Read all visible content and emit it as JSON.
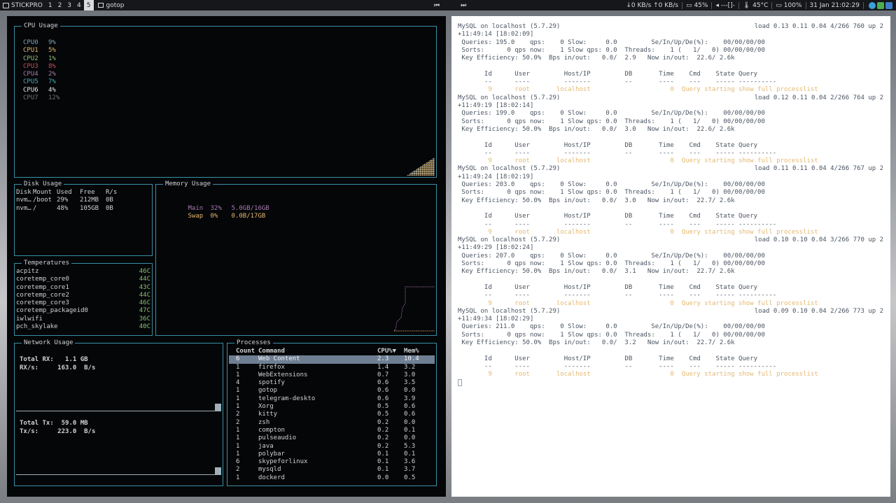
{
  "topbar": {
    "brand": "STICKPRO",
    "workspaces": [
      "1",
      "2",
      "3",
      "4",
      "5"
    ],
    "active_workspace": "5",
    "window_title": "gotop",
    "net": "↓0 KB/s ↑0 KB/s",
    "brightness": "45%",
    "volume": "---[]-",
    "temp": "45°C",
    "battery": "100%",
    "datetime": "31 Jan 21:02:29"
  },
  "gotop": {
    "cpu": {
      "title": "CPU Usage",
      "cores": [
        {
          "name": "CPU0",
          "value": "9%",
          "color": "#7aa2b8"
        },
        {
          "name": "CPU1",
          "value": "5%",
          "color": "#e5b870"
        },
        {
          "name": "CPU2",
          "value": "1%",
          "color": "#8dbf77"
        },
        {
          "name": "CPU3",
          "value": "8%",
          "color": "#c0505a"
        },
        {
          "name": "CPU4",
          "value": "2%",
          "color": "#a77bb1"
        },
        {
          "name": "CPU5",
          "value": "7%",
          "color": "#4fa9b8"
        },
        {
          "name": "CPU6",
          "value": "4%",
          "color": "#e8e8e8"
        },
        {
          "name": "CPU7",
          "value": "12%",
          "color": "#6f7378"
        }
      ]
    },
    "disk": {
      "title": "Disk Usage",
      "headers": [
        "Disk",
        "Mount",
        "Used",
        "Free",
        "R/s"
      ],
      "rows": [
        [
          "nvm…",
          "/boot",
          "29%",
          "212MB",
          "0B"
        ],
        [
          "nvm…",
          "/",
          "48%",
          "105GB",
          "0B"
        ]
      ]
    },
    "memory": {
      "title": "Memory Usage",
      "main": {
        "label": "Main",
        "pct": "32%",
        "value": "5.0GB/16GB"
      },
      "swap": {
        "label": "Swap",
        "pct": "0%",
        "value": "0.0B/17GB"
      }
    },
    "temps": {
      "title": "Temperatures",
      "rows": [
        [
          "acpitz",
          "46C"
        ],
        [
          "coretemp_core0",
          "44C"
        ],
        [
          "coretemp_core1",
          "43C"
        ],
        [
          "coretemp_core2",
          "44C"
        ],
        [
          "coretemp_core3",
          "46C"
        ],
        [
          "coretemp_packageid0",
          "47C"
        ],
        [
          "iwlwifi",
          "36C"
        ],
        [
          "pch_skylake",
          "40C"
        ]
      ]
    },
    "network": {
      "title": "Network Usage",
      "rx_total": "Total RX:   1.1 GB",
      "rx_rate": "RX/s:     163.0  B/s",
      "tx_total": "Total Tx:  59.0 MB",
      "tx_rate": "Tx/s:     223.0  B/s"
    },
    "processes": {
      "title": "Processes",
      "headers": [
        "Count",
        "Command",
        "CPU%▼",
        "Mem%"
      ],
      "rows": [
        [
          "6",
          "Web Content",
          "2.3",
          "10.4"
        ],
        [
          "1",
          "firefox",
          "1.4",
          "3.2"
        ],
        [
          "1",
          "WebExtensions",
          "0.7",
          "3.0"
        ],
        [
          "4",
          "spotify",
          "0.6",
          "3.5"
        ],
        [
          "1",
          "gotop",
          "0.6",
          "0.0"
        ],
        [
          "1",
          "telegram-deskto",
          "0.6",
          "3.9"
        ],
        [
          "1",
          "Xorg",
          "0.5",
          "0.6"
        ],
        [
          "2",
          "kitty",
          "0.5",
          "0.6"
        ],
        [
          "2",
          "zsh",
          "0.2",
          "0.0"
        ],
        [
          "1",
          "compton",
          "0.2",
          "0.1"
        ],
        [
          "1",
          "pulseaudio",
          "0.2",
          "0.0"
        ],
        [
          "1",
          "java",
          "0.2",
          "5.3"
        ],
        [
          "1",
          "polybar",
          "0.1",
          "0.1"
        ],
        [
          "6",
          "skypeforlinux",
          "0.1",
          "3.6"
        ],
        [
          "2",
          "mysqld",
          "0.1",
          "3.7"
        ],
        [
          "1",
          "dockerd",
          "0.0",
          "0.5"
        ]
      ]
    }
  },
  "mytop": {
    "blocks": [
      {
        "l1": "MySQL on localhost (5.7.29)",
        "load": "load 0.13 0.11 0.04 4/266 760 up 2",
        "l2": "+11:49:14 [18:02:09]",
        "l3": " Queries: 195.0    qps:    0 Slow:     0.0         Se/In/Up/De(%):    00/00/00/00",
        "l4": " Sorts:      0 qps now:    1 Slow qps: 0.0  Threads:    1 (   1/   0) 00/00/00/00",
        "l5": " Key Efficiency: 50.0%  Bps in/out:   0.0/  2.9   Now in/out:  22.6/ 2.6k"
      },
      {
        "l1": "MySQL on localhost (5.7.29)",
        "load": "load 0.12 0.11 0.04 2/266 764 up 2",
        "l2": "+11:49:19 [18:02:14]",
        "l3": " Queries: 199.0    qps:    0 Slow:     0.0         Se/In/Up/De(%):    00/00/00/00",
        "l4": " Sorts:      0 qps now:    1 Slow qps: 0.0  Threads:    1 (   1/   0) 00/00/00/00",
        "l5": " Key Efficiency: 50.0%  Bps in/out:   0.0/  3.0   Now in/out:  22.6/ 2.6k"
      },
      {
        "l1": "MySQL on localhost (5.7.29)",
        "load": "load 0.11 0.11 0.04 4/266 767 up 2",
        "l2": "+11:49:24 [18:02:19]",
        "l3": " Queries: 203.0    qps:    0 Slow:     0.0         Se/In/Up/De(%):    00/00/00/00",
        "l4": " Sorts:      0 qps now:    1 Slow qps: 0.0  Threads:    1 (   1/   0) 00/00/00/00",
        "l5": " Key Efficiency: 50.0%  Bps in/out:   0.0/  3.0   Now in/out:  22.7/ 2.6k"
      },
      {
        "l1": "MySQL on localhost (5.7.29)",
        "load": "load 0.10 0.10 0.04 3/266 770 up 2",
        "l2": "+11:49:29 [18:02:24]",
        "l3": " Queries: 207.0    qps:    0 Slow:     0.0         Se/In/Up/De(%):    00/00/00/00",
        "l4": " Sorts:      0 qps now:    1 Slow qps: 0.0  Threads:    1 (   1/   0) 00/00/00/00",
        "l5": " Key Efficiency: 50.0%  Bps in/out:   0.0/  3.1   Now in/out:  22.7/ 2.6k"
      },
      {
        "l1": "MySQL on localhost (5.7.29)",
        "load": "load 0.09 0.10 0.04 2/266 773 up 2",
        "l2": "+11:49:34 [18:02:29]",
        "l3": " Queries: 211.0    qps:    0 Slow:     0.0         Se/In/Up/De(%):    00/00/00/00",
        "l4": " Sorts:      0 qps now:    1 Slow qps: 0.0  Threads:    1 (   1/   0) 00/00/00/00",
        "l5": " Key Efficiency: 50.0%  Bps in/out:   0.0/  3.2   Now in/out:  22.7/ 2.6k"
      }
    ],
    "header": "       Id      User         Host/IP         DB       Time    Cmd    State Query",
    "sep": "       --      ----         -------         --       ----    ---    ----- ----------",
    "proc": "        9      root       localhost                     0  Query starting show full processlist"
  }
}
